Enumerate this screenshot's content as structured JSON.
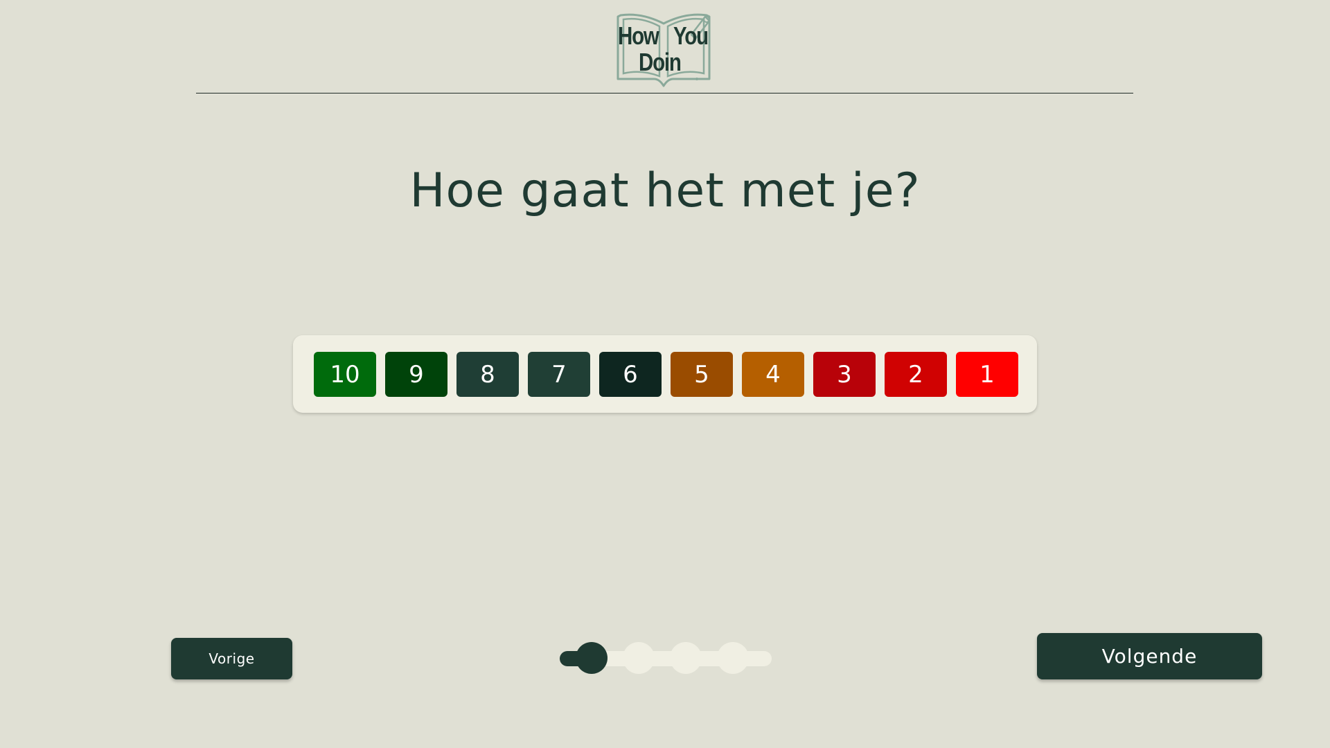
{
  "logo": {
    "line1_left": "How",
    "line1_right": "You",
    "line2": "Doin"
  },
  "question": "Hoe gaat het met je?",
  "scale": [
    {
      "label": "10",
      "color": "#006b0c"
    },
    {
      "label": "9",
      "color": "#00430a"
    },
    {
      "label": "8",
      "color": "#1f3e35"
    },
    {
      "label": "7",
      "color": "#203f35"
    },
    {
      "label": "6",
      "color": "#0e2620"
    },
    {
      "label": "5",
      "color": "#9a4c00"
    },
    {
      "label": "4",
      "color": "#b55f00"
    },
    {
      "label": "3",
      "color": "#b80209"
    },
    {
      "label": "2",
      "color": "#d00202"
    },
    {
      "label": "1",
      "color": "#ff0000"
    }
  ],
  "nav": {
    "prev_label": "Vorige",
    "next_label": "Volgende"
  },
  "progress": {
    "current_step": 1,
    "total_steps": 4
  },
  "colors": {
    "background": "#e0e0d4",
    "accent": "#1f3a32",
    "panel": "#f0efe3"
  }
}
